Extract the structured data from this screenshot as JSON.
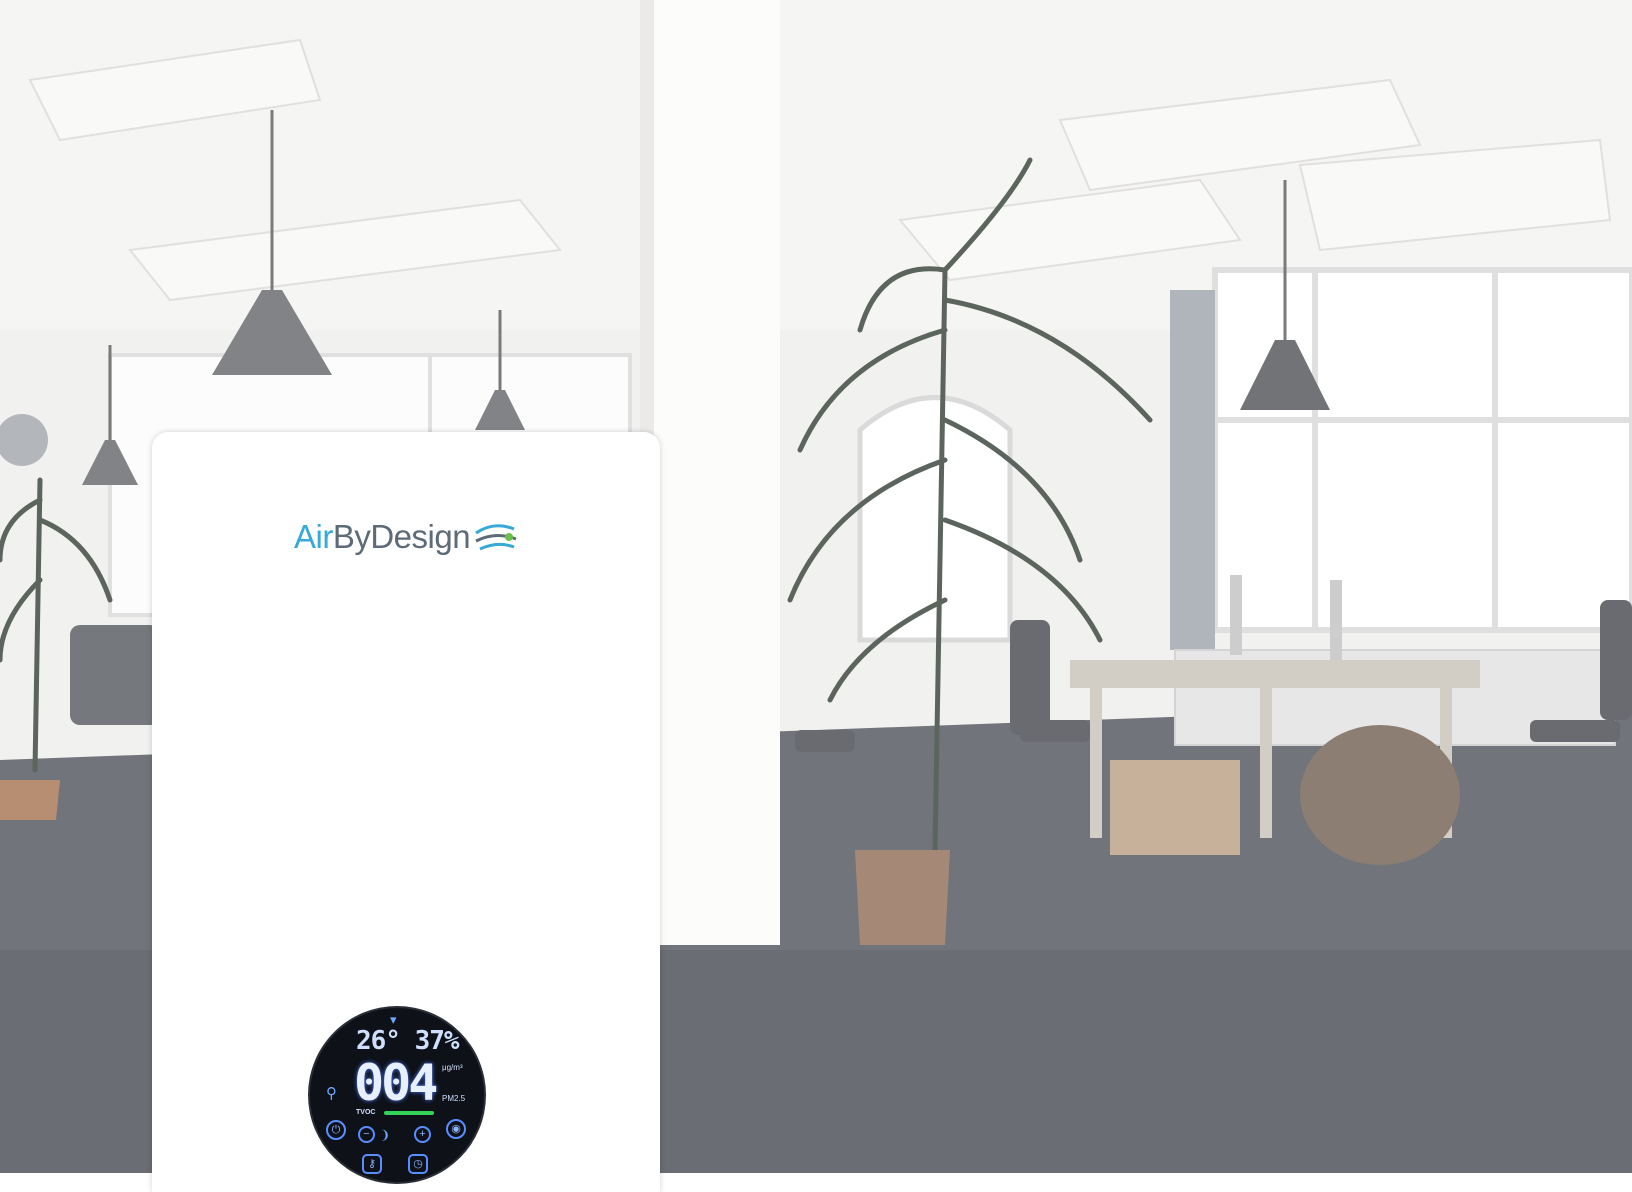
{
  "scene": {
    "description_icons": [
      "pendant-lamp",
      "potted-palm",
      "window",
      "office-desk",
      "office-chair",
      "cardboard-box",
      "pouf"
    ],
    "colors": {
      "floor": "#3e4249",
      "wall": "#ecebea",
      "ceiling": "#f1f0ef",
      "lamp": "#4a4c50"
    }
  },
  "device": {
    "brand_first": "Air",
    "brand_rest": "ByDesign",
    "colors": {
      "brand_blue": "#36a9d8",
      "brand_grey": "#5d6a78"
    },
    "display": {
      "temperature": "26°",
      "humidity": "37%",
      "pm_value": "004",
      "pm_unit": "μg/m³",
      "pm_label": "PM2.5",
      "tvoc_label": "TVOC",
      "tvoc_level": 0.8
    }
  }
}
